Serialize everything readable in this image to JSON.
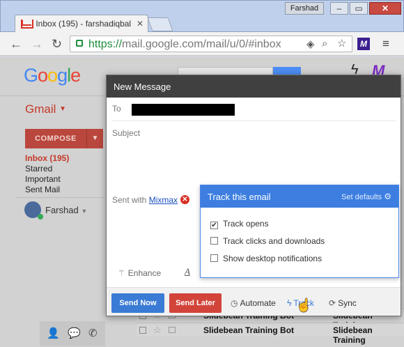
{
  "browser": {
    "tab_title": "Inbox (195) - farshadiqbal",
    "tab_close": "✕",
    "user_chip": "Farshad",
    "window_min": "–",
    "window_max": "▭",
    "window_close": "✕",
    "url_https": "https://",
    "url_rest": "mail.google.com/mail/u/0/#inbox",
    "ext_label": "M"
  },
  "gmail": {
    "logo_letters": [
      "G",
      "o",
      "o",
      "g",
      "l",
      "e"
    ],
    "app_label": "Gmail",
    "compose_label": "COMPOSE",
    "nav": [
      "Inbox (195)",
      "Starred",
      "Important",
      "Sent Mail"
    ],
    "user_name": "Farshad",
    "rows": [
      {
        "sender": "Slidebean Training Bot",
        "subject": "Slidebean Training"
      },
      {
        "sender": "Slidebean Training Bot",
        "subject": "Slidebean Training"
      }
    ]
  },
  "compose_window": {
    "title": "New Message",
    "to_label": "To",
    "subject_label": "Subject",
    "sent_with_prefix": "Sent with ",
    "sent_with_link": "Mixmax",
    "enhance_label": "Enhance",
    "format_label": "A",
    "footer": {
      "send_now": "Send Now",
      "send_later": "Send Later",
      "automate": "Automate",
      "track": "Track",
      "sync": "Sync"
    }
  },
  "track_popover": {
    "title": "Track this email",
    "set_defaults": "Set defaults",
    "options": [
      {
        "label": "Track opens",
        "checked": true
      },
      {
        "label": "Track clicks and downloads",
        "checked": false
      },
      {
        "label": "Show desktop notifications",
        "checked": false
      }
    ]
  },
  "colors": {
    "accent_blue": "#3d7ee0",
    "send_later_red": "#d2443a",
    "gmail_red": "#c53929"
  }
}
